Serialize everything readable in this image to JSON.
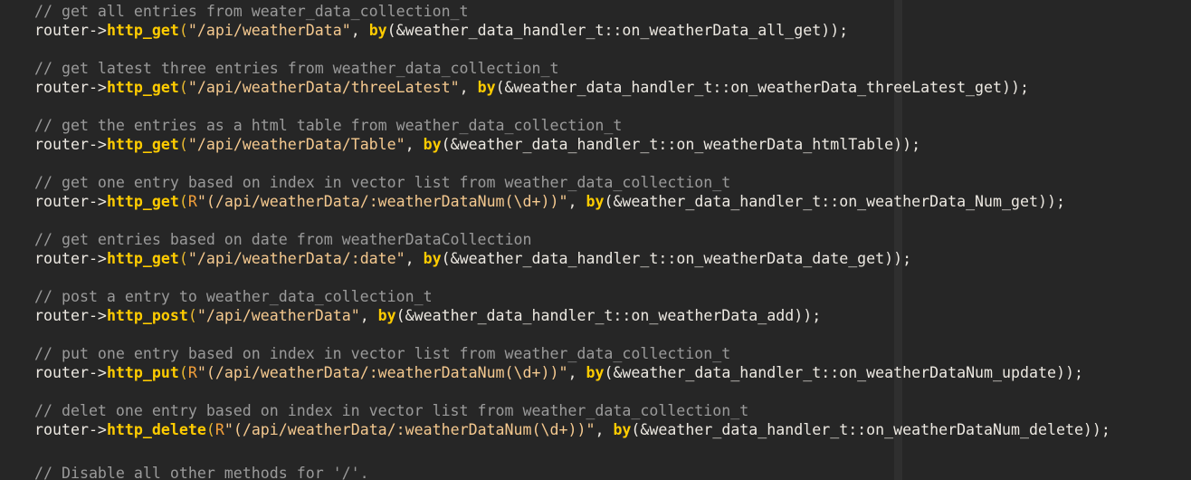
{
  "editor": {
    "colors": {
      "background": "#262626",
      "comment": "#9a9a9a",
      "function": "#ffcc00",
      "string": "#f5c98f",
      "text": "#ece8e1"
    },
    "blocks": [
      {
        "comment": "// get all entries from weater_data_collection_t",
        "obj": "router->",
        "fn": "http_get",
        "raw": "",
        "str": "\"/api/weatherData\"",
        "mid": ", ",
        "by": "by",
        "args": "(&weather_data_handler_t::on_weatherData_all_get));"
      },
      {
        "comment": "// get latest three entries from weather_data_collection_t",
        "obj": "router->",
        "fn": "http_get",
        "raw": "",
        "str": "\"/api/weatherData/threeLatest\"",
        "mid": ", ",
        "by": "by",
        "args": "(&weather_data_handler_t::on_weatherData_threeLatest_get));"
      },
      {
        "comment": "// get the entries as a html table from weather_data_collection_t",
        "obj": "router->",
        "fn": "http_get",
        "raw": "",
        "str": "\"/api/weatherData/Table\"",
        "mid": ", ",
        "by": "by",
        "args": "(&weather_data_handler_t::on_weatherData_htmlTable));"
      },
      {
        "comment": "// get one entry based on index in vector list from weather_data_collection_t",
        "obj": "router->",
        "fn": "http_get",
        "raw": "R",
        "str": "\"(/api/weatherData/:weatherDataNum(\\d+))\"",
        "mid": ", ",
        "by": "by",
        "args": "(&weather_data_handler_t::on_weatherData_Num_get));"
      },
      {
        "comment": "// get entries based on date from weatherDataCollection",
        "obj": "router->",
        "fn": "http_get",
        "raw": "",
        "str": "\"/api/weatherData/:date\"",
        "mid": ", ",
        "by": "by",
        "args": "(&weather_data_handler_t::on_weatherData_date_get));"
      },
      {
        "comment": "// post a entry to weather_data_collection_t",
        "obj": "router->",
        "fn": "http_post",
        "raw": "",
        "str": "\"/api/weatherData\"",
        "mid": ", ",
        "by": "by",
        "args": "(&weather_data_handler_t::on_weatherData_add));"
      },
      {
        "comment": "// put one entry based on index in vector list from weather_data_collection_t",
        "obj": "router->",
        "fn": "http_put",
        "raw": "R",
        "str": "\"(/api/weatherData/:weatherDataNum(\\d+))\"",
        "mid": ", ",
        "by": "by",
        "args": "(&weather_data_handler_t::on_weatherDataNum_update));"
      },
      {
        "comment": "// delet one entry based on index in vector list from weather_data_collection_t",
        "obj": "router->",
        "fn": "http_delete",
        "raw": "R",
        "str": "\"(/api/weatherData/:weatherDataNum(\\d+))\"",
        "mid": ", ",
        "by": "by",
        "args": "(&weather_data_handler_t::on_weatherDataNum_delete));"
      }
    ],
    "trailing_comment": "// Disable all other methods for '/'."
  }
}
